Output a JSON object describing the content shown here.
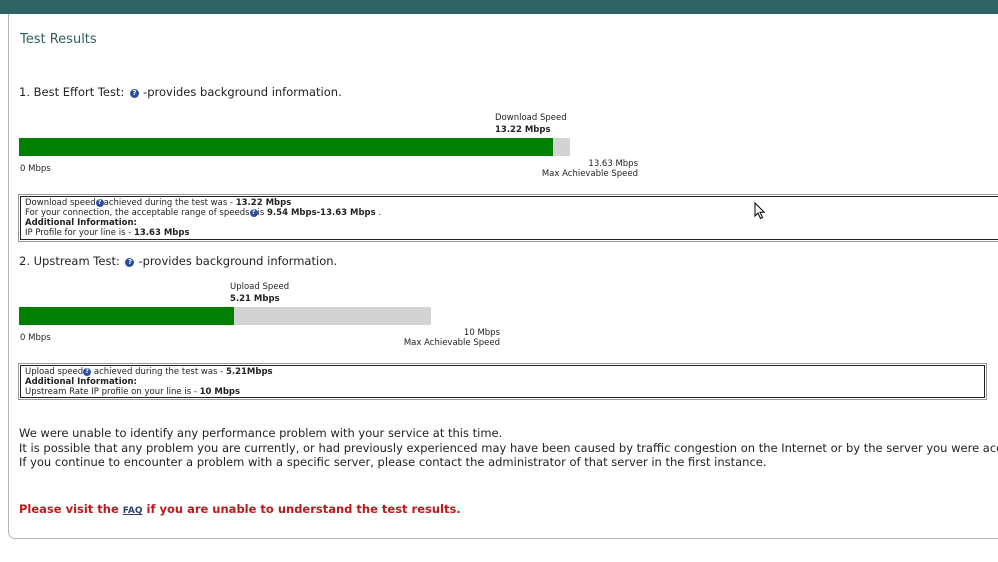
{
  "title": "Test Results",
  "best_effort": {
    "heading_prefix": "1. Best Effort Test:",
    "heading_suffix": "-provides background information.",
    "bar": {
      "label": "Download Speed",
      "value_text": "13.22 Mbps",
      "value": 13.22,
      "max": 13.63,
      "track_fraction": 0.84,
      "min_label": "0 Mbps",
      "max_label": "13.63 Mbps",
      "max_caption": "Max Achievable Speed"
    },
    "info": {
      "line1_prefix": "Download speed",
      "line1_mid": "achieved during the test was - ",
      "line1_value": "13.22 Mbps",
      "line2_prefix": "For your connection, the acceptable range of speeds",
      "line2_mid": "is ",
      "line2_value": "9.54 Mbps-13.63 Mbps",
      "line2_end": " .",
      "line3": "Additional Information:",
      "line4_prefix": "IP Profile for your line is - ",
      "line4_value": "13.63 Mbps"
    }
  },
  "upstream": {
    "heading_prefix": "2. Upstream Test:",
    "heading_suffix": "-provides background information.",
    "bar": {
      "label": "Upload Speed",
      "value_text": "5.21 Mbps",
      "value": 5.21,
      "max": 10,
      "min_label": "0 Mbps",
      "max_label": "10 Mbps",
      "max_caption": "Max Achievable Speed"
    },
    "info": {
      "line1_prefix": "Upload speed",
      "line1_mid": " achieved during the test was - ",
      "line1_value": "5.21Mbps",
      "line2": "Additional Information:",
      "line3_prefix": "Upstream Rate IP profile on your line is - ",
      "line3_value": "10 Mbps"
    }
  },
  "message": {
    "line1": "We were unable to identify any performance problem with your service at this time.",
    "line2": "It is possible that any problem you are currently, or had previously experienced may have been caused by traffic congestion on the Internet or by the server you were accessing.",
    "line3": "If you continue to encounter a problem with a specific server, please contact the administrator of that server in the first instance."
  },
  "faq": {
    "prefix": "Please visit the ",
    "link": "FAQ",
    "suffix": " if you are unable to understand the test results."
  },
  "colors": {
    "topbar": "#2e6466",
    "bar_fill": "#008000",
    "bar_track": "#d3d3d3",
    "warning": "#c0171c",
    "help_icon": "#2b4fa0"
  }
}
